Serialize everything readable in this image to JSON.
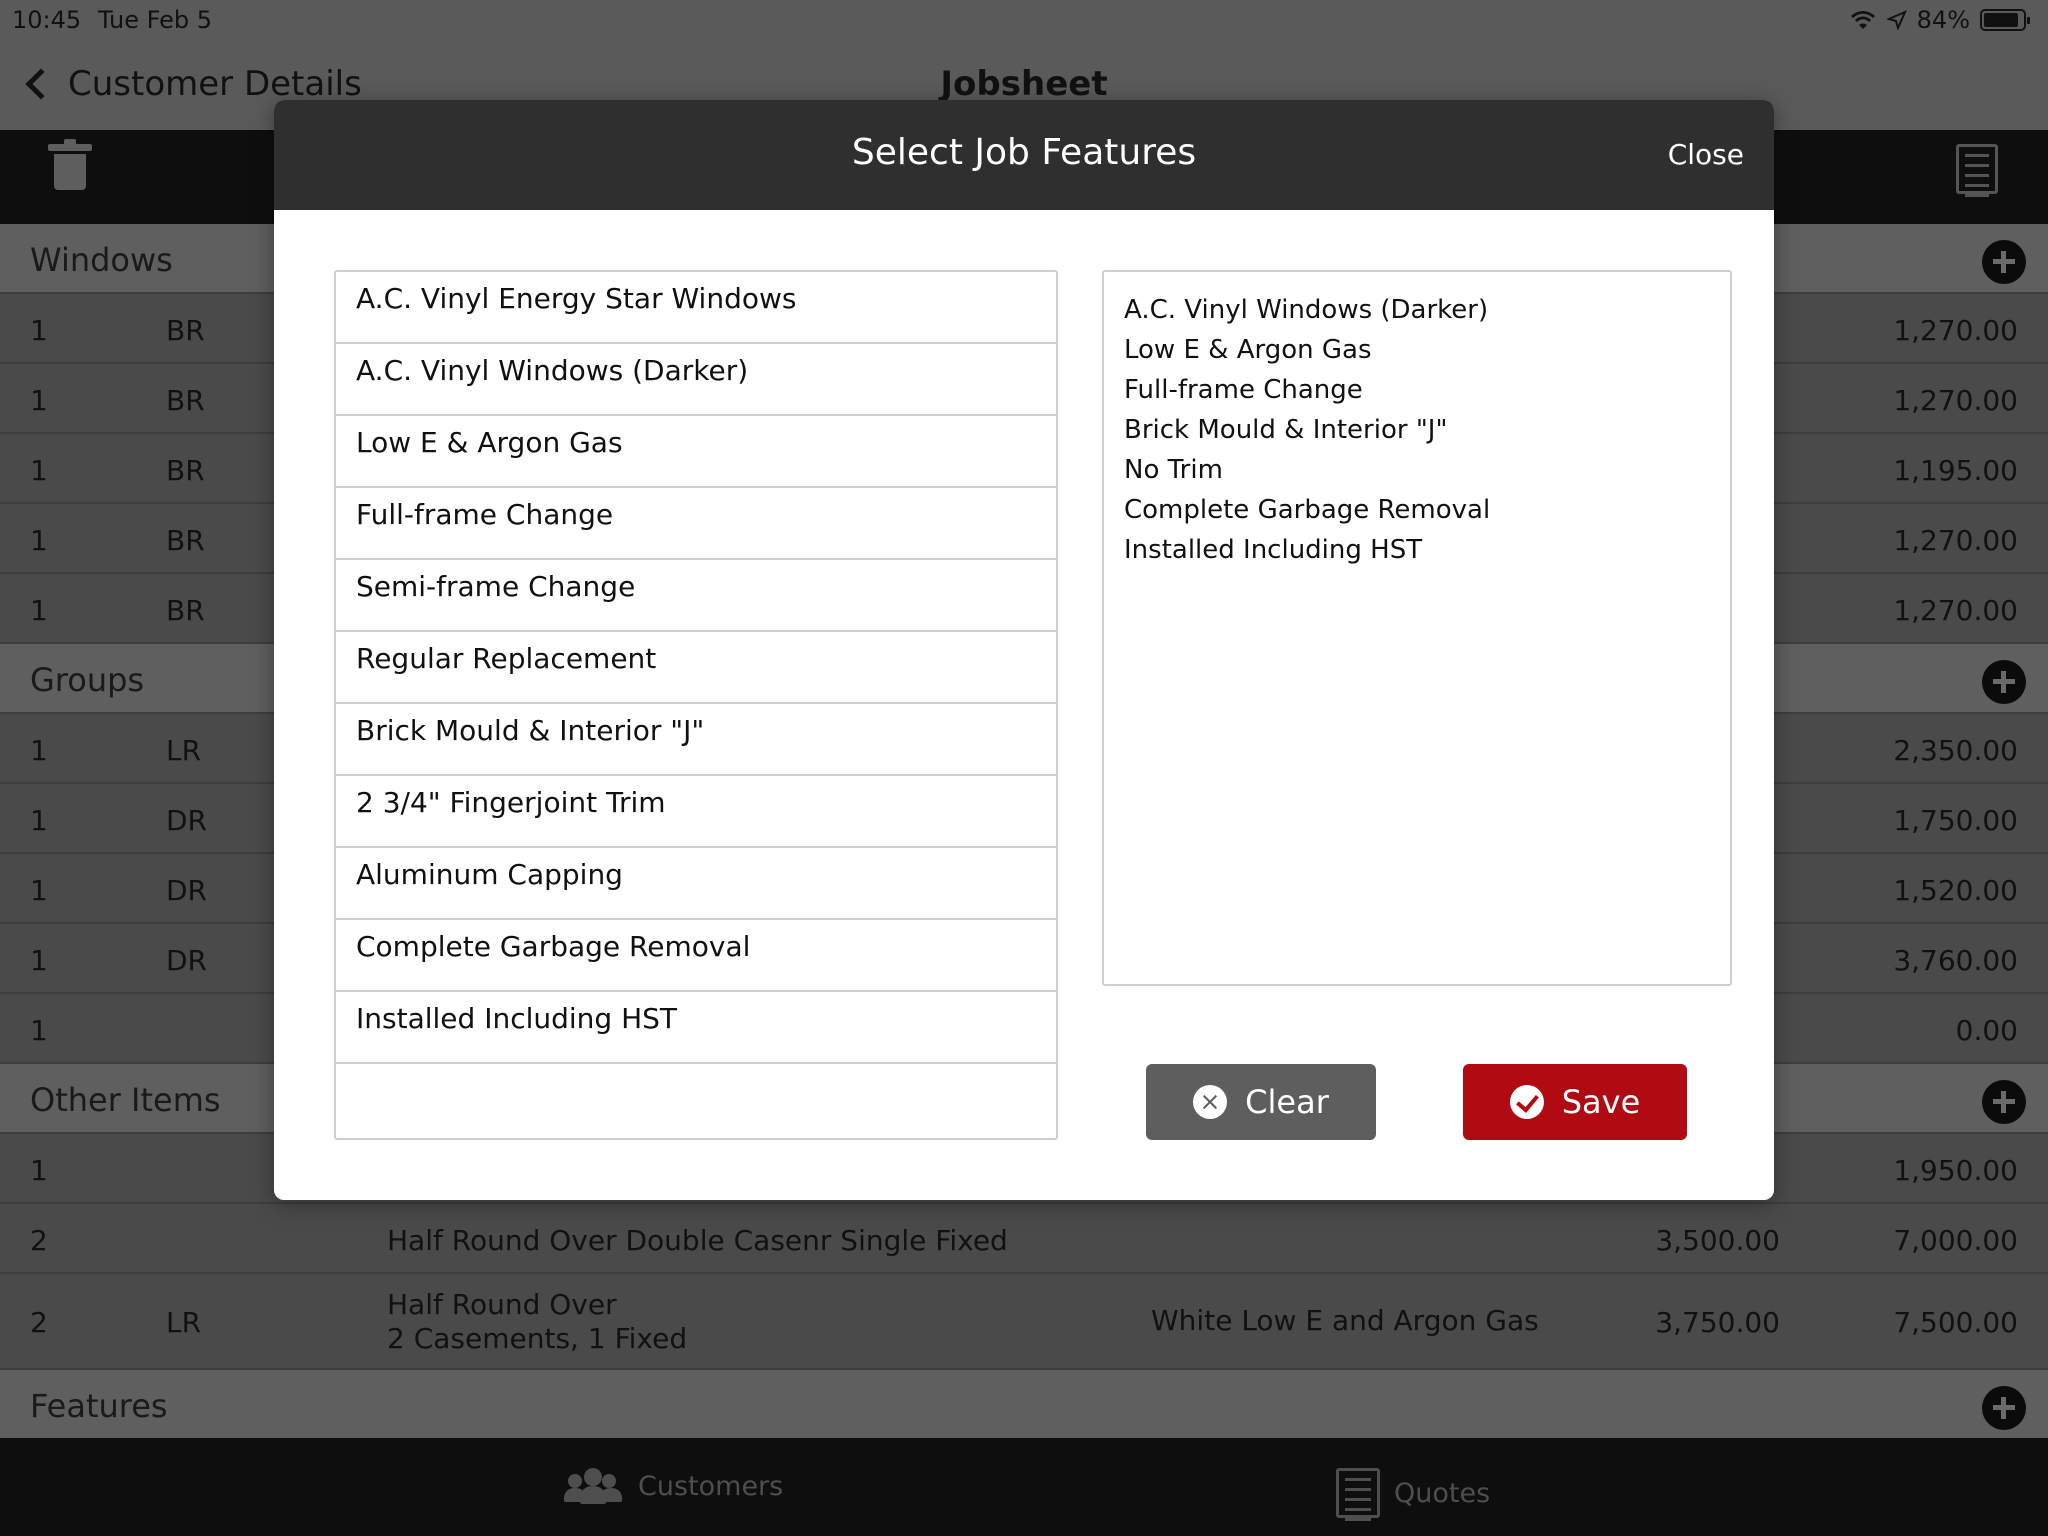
{
  "status": {
    "time": "10:45",
    "date": "Tue Feb 5",
    "battery": "84%"
  },
  "nav": {
    "back_label": "Customer Details",
    "title": "Jobsheet"
  },
  "sections": {
    "windows": "Windows",
    "groups": "Groups",
    "other": "Other Items",
    "features": "Features"
  },
  "window_rows": [
    {
      "qty": "1",
      "room": "BR",
      "total": "1,270.00"
    },
    {
      "qty": "1",
      "room": "BR",
      "total": "1,270.00"
    },
    {
      "qty": "1",
      "room": "BR",
      "total": "1,195.00"
    },
    {
      "qty": "1",
      "room": "BR",
      "total": "1,270.00"
    },
    {
      "qty": "1",
      "room": "BR",
      "total": "1,270.00"
    }
  ],
  "group_rows": [
    {
      "qty": "1",
      "room": "LR",
      "total": "2,350.00"
    },
    {
      "qty": "1",
      "room": "DR",
      "total": "1,750.00"
    },
    {
      "qty": "1",
      "room": "DR",
      "total": "1,520.00"
    },
    {
      "qty": "1",
      "room": "DR",
      "total": "3,760.00"
    },
    {
      "qty": "1",
      "room": "",
      "total": "0.00"
    }
  ],
  "other_rows": [
    {
      "qty": "1",
      "room": "",
      "desc": "",
      "option": "",
      "unit": "",
      "total": "1,950.00"
    },
    {
      "qty": "2",
      "room": "",
      "desc": "Half Round Over Double Casenr Single Fixed",
      "option": "",
      "unit": "3,500.00",
      "total": "7,000.00"
    },
    {
      "qty": "2",
      "room": "LR",
      "desc_line1": "Half Round Over",
      "desc_line2": "2 Casements, 1 Fixed",
      "option": "White Low E and Argon Gas",
      "unit": "3,750.00",
      "total": "7,500.00"
    }
  ],
  "tabs": {
    "customers": "Customers",
    "quotes": "Quotes"
  },
  "modal": {
    "title": "Select Job Features",
    "close": "Close",
    "options": [
      "A.C. Vinyl Energy Star Windows",
      "A.C. Vinyl Windows (Darker)",
      "Low E & Argon Gas",
      "Full-frame Change",
      "Semi-frame Change",
      "Regular Replacement",
      "Brick Mould & Interior \"J\"",
      "2 3/4\" Fingerjoint Trim",
      "Aluminum Capping",
      "Complete Garbage Removal",
      "Installed Including HST"
    ],
    "selected": [
      "A.C. Vinyl Windows (Darker)",
      "Low E & Argon Gas",
      "Full-frame Change",
      "Brick Mould & Interior \"J\"",
      "No Trim",
      "Complete Garbage Removal",
      "Installed Including HST"
    ],
    "clear_label": "Clear",
    "save_label": "Save"
  },
  "colors": {
    "save": "#b00a12",
    "clear": "#5e5e5e",
    "modal_header": "#2f2f2f"
  }
}
